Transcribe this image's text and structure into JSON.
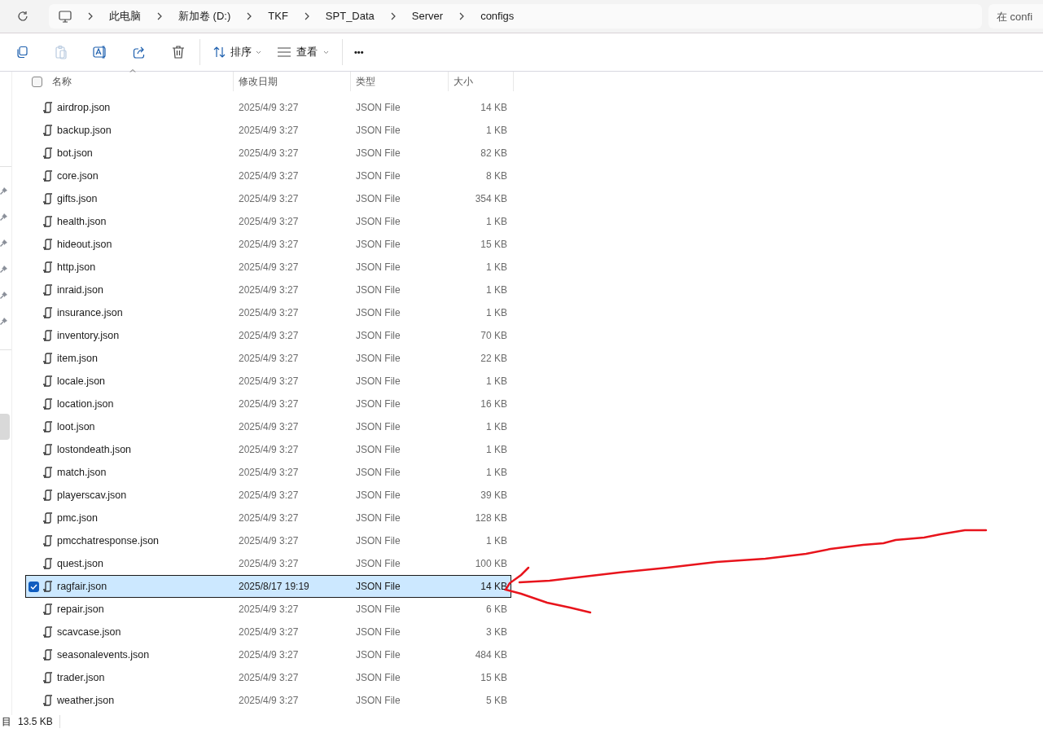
{
  "address_bar": {
    "crumbs": [
      "此电脑",
      "新加卷 (D:)",
      "TKF",
      "SPT_Data",
      "Server",
      "configs"
    ]
  },
  "search": {
    "placeholder": "在 confi"
  },
  "toolbar": {
    "sort_label": "排序",
    "view_label": "查看",
    "more": "•••"
  },
  "table": {
    "all_selected": false,
    "columns": [
      "名称",
      "修改日期",
      "类型",
      "大小"
    ],
    "rows": [
      {
        "name": "airdrop.json",
        "date": "2025/4/9 3:27",
        "type": "JSON File",
        "size": "14 KB",
        "selected": false
      },
      {
        "name": "backup.json",
        "date": "2025/4/9 3:27",
        "type": "JSON File",
        "size": "1 KB",
        "selected": false
      },
      {
        "name": "bot.json",
        "date": "2025/4/9 3:27",
        "type": "JSON File",
        "size": "82 KB",
        "selected": false
      },
      {
        "name": "core.json",
        "date": "2025/4/9 3:27",
        "type": "JSON File",
        "size": "8 KB",
        "selected": false
      },
      {
        "name": "gifts.json",
        "date": "2025/4/9 3:27",
        "type": "JSON File",
        "size": "354 KB",
        "selected": false
      },
      {
        "name": "health.json",
        "date": "2025/4/9 3:27",
        "type": "JSON File",
        "size": "1 KB",
        "selected": false
      },
      {
        "name": "hideout.json",
        "date": "2025/4/9 3:27",
        "type": "JSON File",
        "size": "15 KB",
        "selected": false
      },
      {
        "name": "http.json",
        "date": "2025/4/9 3:27",
        "type": "JSON File",
        "size": "1 KB",
        "selected": false
      },
      {
        "name": "inraid.json",
        "date": "2025/4/9 3:27",
        "type": "JSON File",
        "size": "1 KB",
        "selected": false
      },
      {
        "name": "insurance.json",
        "date": "2025/4/9 3:27",
        "type": "JSON File",
        "size": "1 KB",
        "selected": false
      },
      {
        "name": "inventory.json",
        "date": "2025/4/9 3:27",
        "type": "JSON File",
        "size": "70 KB",
        "selected": false
      },
      {
        "name": "item.json",
        "date": "2025/4/9 3:27",
        "type": "JSON File",
        "size": "22 KB",
        "selected": false
      },
      {
        "name": "locale.json",
        "date": "2025/4/9 3:27",
        "type": "JSON File",
        "size": "1 KB",
        "selected": false
      },
      {
        "name": "location.json",
        "date": "2025/4/9 3:27",
        "type": "JSON File",
        "size": "16 KB",
        "selected": false
      },
      {
        "name": "loot.json",
        "date": "2025/4/9 3:27",
        "type": "JSON File",
        "size": "1 KB",
        "selected": false
      },
      {
        "name": "lostondeath.json",
        "date": "2025/4/9 3:27",
        "type": "JSON File",
        "size": "1 KB",
        "selected": false
      },
      {
        "name": "match.json",
        "date": "2025/4/9 3:27",
        "type": "JSON File",
        "size": "1 KB",
        "selected": false
      },
      {
        "name": "playerscav.json",
        "date": "2025/4/9 3:27",
        "type": "JSON File",
        "size": "39 KB",
        "selected": false
      },
      {
        "name": "pmc.json",
        "date": "2025/4/9 3:27",
        "type": "JSON File",
        "size": "128 KB",
        "selected": false
      },
      {
        "name": "pmcchatresponse.json",
        "date": "2025/4/9 3:27",
        "type": "JSON File",
        "size": "1 KB",
        "selected": false
      },
      {
        "name": "quest.json",
        "date": "2025/4/9 3:27",
        "type": "JSON File",
        "size": "100 KB",
        "selected": false
      },
      {
        "name": "ragfair.json",
        "date": "2025/8/17 19:19",
        "type": "JSON File",
        "size": "14 KB",
        "selected": true
      },
      {
        "name": "repair.json",
        "date": "2025/4/9 3:27",
        "type": "JSON File",
        "size": "6 KB",
        "selected": false
      },
      {
        "name": "scavcase.json",
        "date": "2025/4/9 3:27",
        "type": "JSON File",
        "size": "3 KB",
        "selected": false
      },
      {
        "name": "seasonalevents.json",
        "date": "2025/4/9 3:27",
        "type": "JSON File",
        "size": "484 KB",
        "selected": false
      },
      {
        "name": "trader.json",
        "date": "2025/4/9 3:27",
        "type": "JSON File",
        "size": "15 KB",
        "selected": false
      },
      {
        "name": "weather.json",
        "date": "2025/4/9 3:27",
        "type": "JSON File",
        "size": "5 KB",
        "selected": false
      }
    ]
  },
  "status_bar": {
    "items": "目",
    "selected_size": "13.5 KB"
  }
}
